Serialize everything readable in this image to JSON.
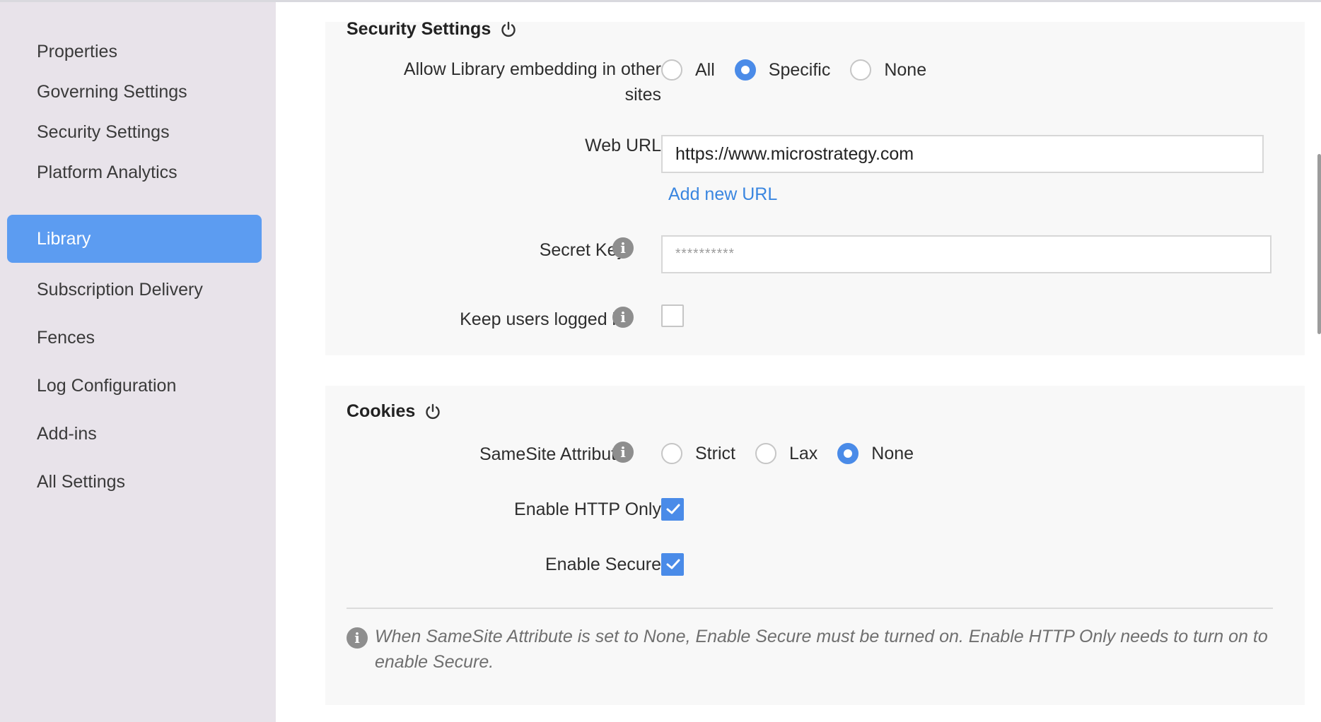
{
  "sidebar": {
    "items": [
      {
        "label": "Properties"
      },
      {
        "label": "Governing Settings"
      },
      {
        "label": "Security Settings"
      },
      {
        "label": "Platform Analytics"
      },
      {
        "label": "Library"
      },
      {
        "label": "Subscription Delivery"
      },
      {
        "label": "Fences"
      },
      {
        "label": "Log Configuration"
      },
      {
        "label": "Add-ins"
      },
      {
        "label": "All Settings"
      }
    ],
    "active_index": 4
  },
  "security": {
    "title": "Security Settings",
    "embedding": {
      "label_line1": "Allow Library embedding in other",
      "label_line2": "sites",
      "options": [
        "All",
        "Specific",
        "None"
      ],
      "selected": "Specific"
    },
    "web_url": {
      "label": "Web URL",
      "value": "https://www.microstrategy.com",
      "add_link": "Add new URL"
    },
    "secret_key": {
      "label": "Secret Key",
      "value": "**********"
    },
    "keep_logged_in": {
      "label": "Keep users logged in",
      "checked": false
    }
  },
  "cookies": {
    "title": "Cookies",
    "samesite": {
      "label": "SameSite Attribute",
      "options": [
        "Strict",
        "Lax",
        "None"
      ],
      "selected": "None"
    },
    "http_only": {
      "label": "Enable HTTP Only",
      "checked": true
    },
    "secure": {
      "label": "Enable Secure",
      "checked": true
    },
    "note_line1": "When SameSite Attribute is set to None, Enable Secure must be turned on. Enable HTTP Only needs to turn on to",
    "note_line2": "enable Secure."
  },
  "colors": {
    "accent": "#4a8be8",
    "active_nav": "#5c9cf1",
    "sidebar_bg": "#e8e3ea",
    "link": "#3a86e0"
  },
  "icons": {
    "reset": "power-icon",
    "info": "info-icon",
    "check": "check-icon"
  }
}
